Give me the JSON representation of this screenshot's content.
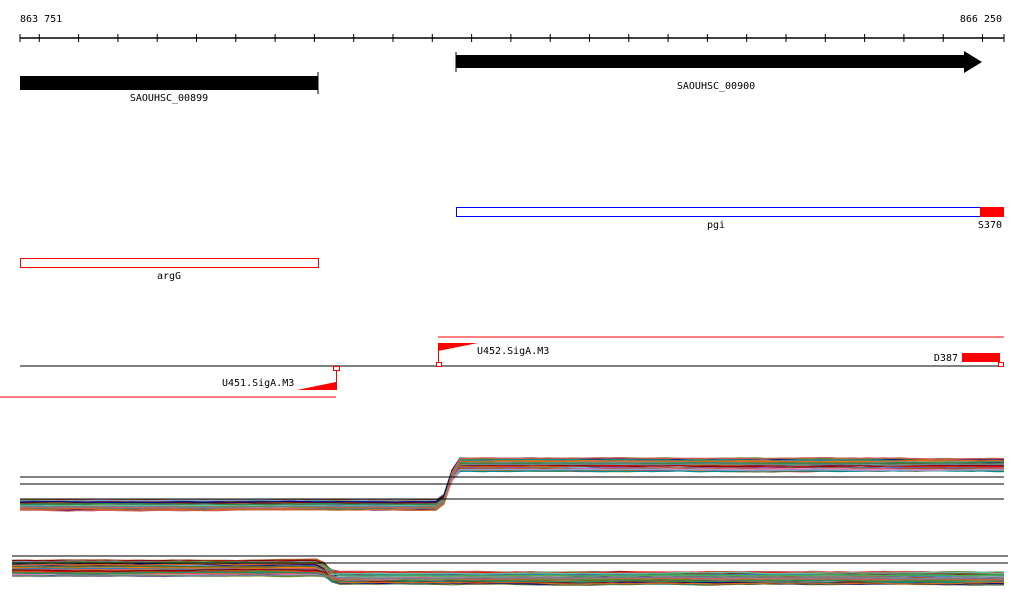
{
  "chart_data": {
    "type": "line",
    "title": "",
    "xlabel": "",
    "ylabel": "",
    "xlim": [
      863751,
      866250
    ],
    "ruler": {
      "start_label": "863 751",
      "end_label": "866 250"
    },
    "genes": [
      {
        "name": "SAOUHSC_00899",
        "start": 863751,
        "end": 864508,
        "strand": "-"
      },
      {
        "name": "SAOUHSC_00900",
        "start": 864860,
        "end": 866190,
        "strand": "+"
      }
    ],
    "features": [
      {
        "name": "pgi",
        "start": 864860,
        "end": 866250,
        "color": "#0000ff"
      },
      {
        "name": "argG",
        "start": 863751,
        "end": 864508,
        "color": "#ff0000"
      },
      {
        "name": "S370",
        "start": 866190,
        "end": 866250,
        "color": "#ff0000"
      }
    ],
    "promoters": [
      {
        "name": "U452.SigA.M3",
        "position": 864815,
        "strand": "+"
      },
      {
        "name": "U451.SigA.M3",
        "position": 864555,
        "strand": "-"
      }
    ],
    "segments": [
      {
        "name": "D387",
        "start": 866145,
        "end": 866240
      }
    ],
    "expression_tracks": [
      {
        "strand": "+",
        "step_position": 864830,
        "level_before": "low",
        "level_after": "high"
      },
      {
        "strand": "-",
        "step_position": 864555,
        "level_before": "high",
        "level_after": "low"
      }
    ],
    "colors": {
      "red": "#ff0000",
      "blue": "#0000ff",
      "black": "#000000"
    }
  }
}
